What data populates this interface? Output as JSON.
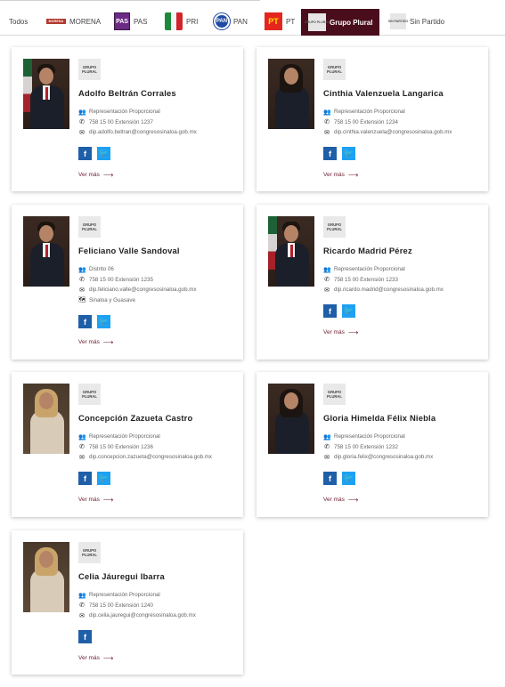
{
  "tabs": [
    {
      "label": "Todos",
      "logo": "none"
    },
    {
      "label": "MORENA",
      "logo": "morena",
      "logo_text": "MORENA"
    },
    {
      "label": "PAS",
      "logo": "pas",
      "logo_text": "PAS"
    },
    {
      "label": "PRI",
      "logo": "pri",
      "logo_text": ""
    },
    {
      "label": "PAN",
      "logo": "pan",
      "logo_text": "PAN"
    },
    {
      "label": "PT",
      "logo": "pt",
      "logo_text": "PT"
    },
    {
      "label": "Grupo Plural",
      "logo": "grupo-plural",
      "logo_text": "GRUPO PLURAL",
      "active": true
    },
    {
      "label": "Sin Partido",
      "logo": "sin-partido",
      "logo_text": "SIN PARTIDO"
    }
  ],
  "colors": {
    "active_tab_bg": "#4a0d1c",
    "link_color": "#6b1a2e",
    "facebook": "#1f5fa8",
    "twitter": "#1da1f2"
  },
  "common": {
    "badge_text": "GRUPO PLURAL",
    "ver_mas": "Ver más",
    "ver_mas_arrow": "⟶",
    "facebook_glyph": "f",
    "twitter_glyph": "🐦"
  },
  "deputies": [
    {
      "name": "Adolfo Beltrán Corrales",
      "rows": [
        {
          "icon": "users-icon",
          "glyph": "👥",
          "text": "Representación Proporcional"
        },
        {
          "icon": "phone-icon",
          "glyph": "✆",
          "text": "758 15 00 Extensión 1237"
        },
        {
          "icon": "envelope-icon",
          "glyph": "✉",
          "text": "dip.adolfo.beltran@congresosinaloa.gob.mx"
        }
      ],
      "social": [
        "facebook",
        "twitter"
      ]
    },
    {
      "name": "Cinthia Valenzuela Langarica",
      "rows": [
        {
          "icon": "users-icon",
          "glyph": "👥",
          "text": "Representación Proporcional"
        },
        {
          "icon": "phone-icon",
          "glyph": "✆",
          "text": "758 15 00 Extensión 1234"
        },
        {
          "icon": "envelope-icon",
          "glyph": "✉",
          "text": "dip.cinthia.valenzuela@congresosinaloa.gob.mx"
        }
      ],
      "social": [
        "facebook",
        "twitter"
      ]
    },
    {
      "name": "Feliciano Valle Sandoval",
      "rows": [
        {
          "icon": "users-icon",
          "glyph": "👥",
          "text": "Distrito 06"
        },
        {
          "icon": "phone-icon",
          "glyph": "✆",
          "text": "758 15 00 Extensión 1235"
        },
        {
          "icon": "envelope-icon",
          "glyph": "✉",
          "text": "dip.feliciano.valle@congresosinaloa.gob.mx"
        },
        {
          "icon": "map-icon",
          "glyph": "🗺",
          "text": "Sinaloa y Guasave"
        }
      ],
      "social": [
        "facebook",
        "twitter"
      ]
    },
    {
      "name": "Ricardo Madrid Pérez",
      "rows": [
        {
          "icon": "users-icon",
          "glyph": "👥",
          "text": "Representación Proporcional"
        },
        {
          "icon": "phone-icon",
          "glyph": "✆",
          "text": "758 15 00 Extensión 1233"
        },
        {
          "icon": "envelope-icon",
          "glyph": "✉",
          "text": "dip.ricardo.madrid@congresosinaloa.gob.mx"
        }
      ],
      "social": [
        "facebook",
        "twitter"
      ]
    },
    {
      "name": "Concepción Zazueta Castro",
      "rows": [
        {
          "icon": "users-icon",
          "glyph": "👥",
          "text": "Representación Proporcional"
        },
        {
          "icon": "phone-icon",
          "glyph": "✆",
          "text": "758 15 00 Extensión 1236"
        },
        {
          "icon": "envelope-icon",
          "glyph": "✉",
          "text": "dip.concepcion.zazueta@congresosinaloa.gob.mx"
        }
      ],
      "social": [
        "facebook",
        "twitter"
      ]
    },
    {
      "name": "Gloria Himelda Félix Niebla",
      "rows": [
        {
          "icon": "users-icon",
          "glyph": "👥",
          "text": "Representación Proporcional"
        },
        {
          "icon": "phone-icon",
          "glyph": "✆",
          "text": "758 15 00 Extensión 1232"
        },
        {
          "icon": "envelope-icon",
          "glyph": "✉",
          "text": "dip.gloria.felix@congresosinaloa.gob.mx"
        }
      ],
      "social": [
        "facebook",
        "twitter"
      ]
    },
    {
      "name": "Celia Jáuregui Ibarra",
      "rows": [
        {
          "icon": "users-icon",
          "glyph": "👥",
          "text": "Representación Proporcional"
        },
        {
          "icon": "phone-icon",
          "glyph": "✆",
          "text": "758 15 00 Extensión 1240"
        },
        {
          "icon": "envelope-icon",
          "glyph": "✉",
          "text": "dip.celia.jauregui@congresosinaloa.gob.mx"
        }
      ],
      "social": [
        "facebook"
      ]
    }
  ]
}
